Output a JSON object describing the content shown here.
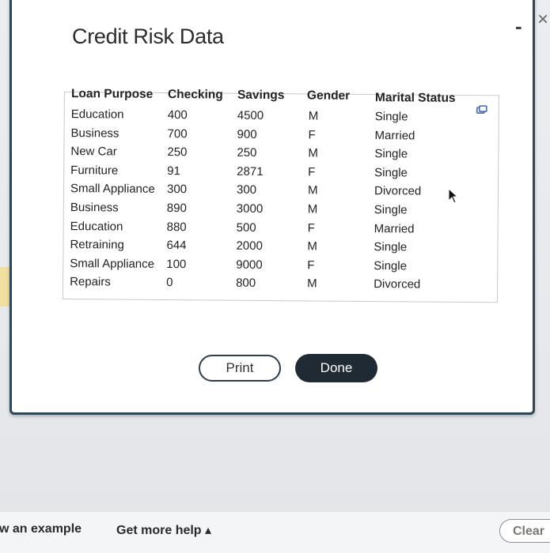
{
  "window": {
    "title": "Credit Risk Data",
    "minimize_label": "-",
    "close_label": "×"
  },
  "table": {
    "headers": [
      "Loan Purpose",
      "Checking",
      "Savings",
      "Gender",
      "Marital Status"
    ],
    "rows": [
      [
        "Education",
        "400",
        "4500",
        "M",
        "Single"
      ],
      [
        "Business",
        "700",
        "900",
        "F",
        "Married"
      ],
      [
        "New Car",
        "250",
        "250",
        "M",
        "Single"
      ],
      [
        "Furniture",
        "91",
        "2871",
        "F",
        "Single"
      ],
      [
        "Small Appliance",
        "300",
        "300",
        "M",
        "Divorced"
      ],
      [
        "Business",
        "890",
        "3000",
        "M",
        "Single"
      ],
      [
        "Education",
        "880",
        "500",
        "F",
        "Married"
      ],
      [
        "Retraining",
        "644",
        "2000",
        "M",
        "Single"
      ],
      [
        "Small Appliance",
        "100",
        "9000",
        "F",
        "Single"
      ],
      [
        "Repairs",
        "0",
        "800",
        "M",
        "Divorced"
      ]
    ],
    "copy_icon": "copy-icon"
  },
  "buttons": {
    "print": "Print",
    "done": "Done"
  },
  "bottom": {
    "example_link": "w an example",
    "help_link": "Get more help ▴",
    "clear_button": "Clear"
  },
  "colors": {
    "dialog_border": "#2f4656",
    "done_button": "#1f2a35",
    "side_highlight": "#f1dfa0"
  }
}
